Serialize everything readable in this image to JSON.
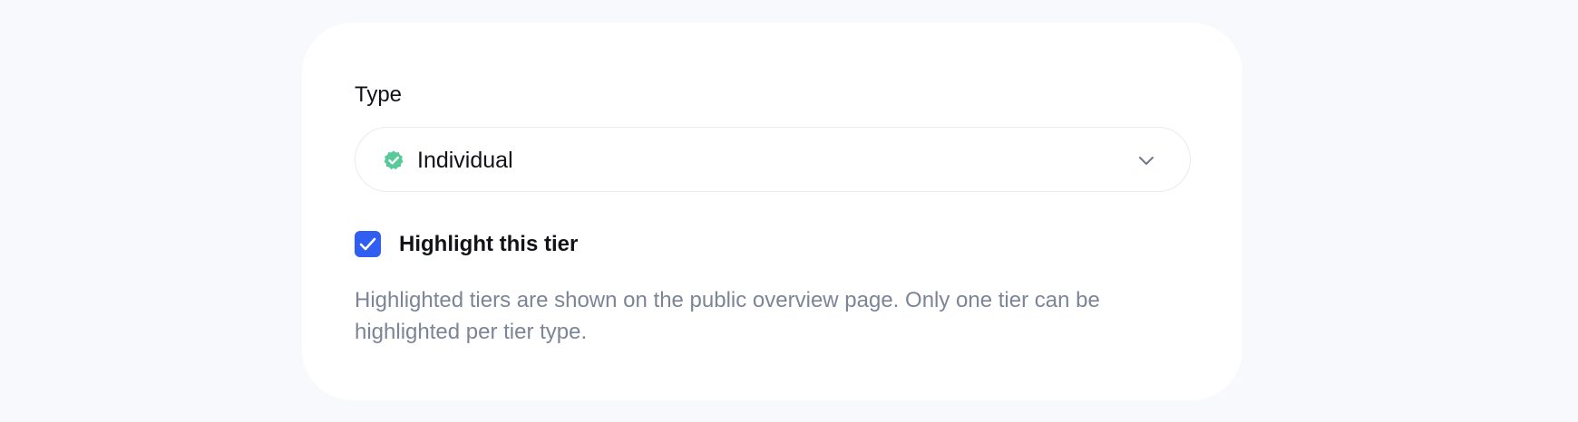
{
  "form": {
    "type_label": "Type",
    "type_select": {
      "selected_value": "Individual",
      "badge_icon": "verified-badge-icon",
      "badge_color": "#59c99a",
      "chevron_icon": "chevron-down-icon"
    },
    "highlight_checkbox": {
      "label": "Highlight this tier",
      "checked": true,
      "color": "#2f5ef0"
    },
    "help_text": "Highlighted tiers are shown on the public overview page. Only one tier can be highlighted per tier type."
  }
}
